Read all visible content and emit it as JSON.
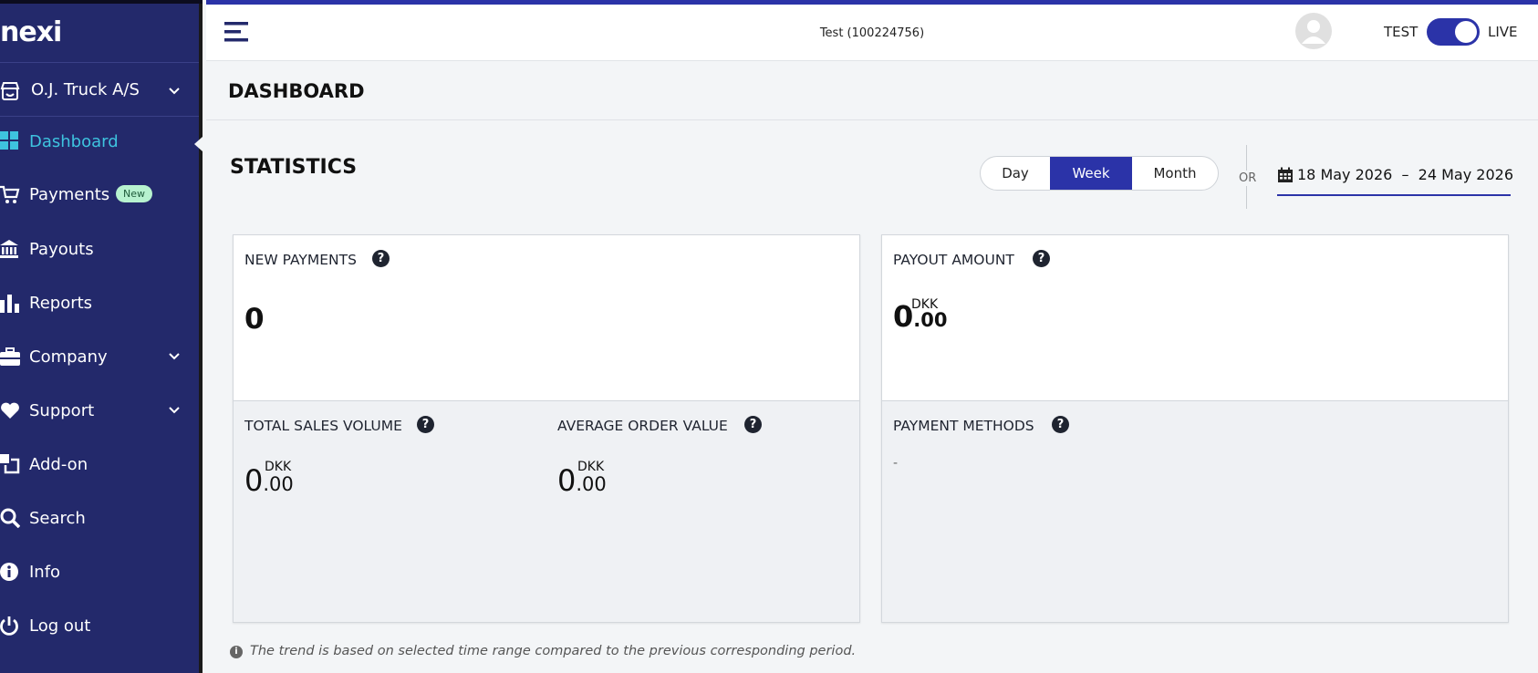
{
  "brand": {
    "logo_text": "nexi",
    "accent": "#2b33a8",
    "sidebar_bg": "#23296b",
    "active_color": "#3ec3df"
  },
  "sidebar": {
    "merchant": {
      "name": "O.J. Truck A/S",
      "icon": "store-icon"
    },
    "items": [
      {
        "label": "Dashboard",
        "icon": "grid-icon",
        "active": true
      },
      {
        "label": "Payments",
        "icon": "cart-icon",
        "badge": "New"
      },
      {
        "label": "Payouts",
        "icon": "bank-icon"
      },
      {
        "label": "Reports",
        "icon": "bar-chart-icon"
      },
      {
        "label": "Company",
        "icon": "briefcase-icon",
        "expandable": true
      },
      {
        "label": "Support",
        "icon": "heart-icon",
        "expandable": true
      },
      {
        "label": "Add-on",
        "icon": "addon-icon"
      },
      {
        "label": "Search",
        "icon": "search-icon"
      },
      {
        "label": "Info",
        "icon": "info-icon"
      },
      {
        "label": "Log out",
        "icon": "power-icon"
      }
    ]
  },
  "header": {
    "account": "Test (100224756)",
    "toggle": {
      "left_label": "TEST",
      "right_label": "LIVE",
      "state": "LIVE"
    }
  },
  "page": {
    "title": "DASHBOARD"
  },
  "statistics": {
    "title": "STATISTICS",
    "ranges": [
      "Day",
      "Week",
      "Month"
    ],
    "selected_range": "Week",
    "or_label": "OR",
    "date_from": "18 May 2026",
    "date_sep": "–",
    "date_to": "24 May 2026"
  },
  "cards": {
    "new_payments": {
      "label": "NEW PAYMENTS",
      "value": "0"
    },
    "payout_amount": {
      "label": "PAYOUT AMOUNT",
      "int": "0",
      "dec": ".00",
      "currency": "DKK"
    },
    "total_sales": {
      "label": "TOTAL SALES VOLUME",
      "int": "0",
      "dec": ".00",
      "currency": "DKK"
    },
    "avg_order": {
      "label": "AVERAGE ORDER VALUE",
      "int": "0",
      "dec": ".00",
      "currency": "DKK"
    },
    "payment_methods": {
      "label": "PAYMENT METHODS",
      "value": "-"
    }
  },
  "help_glyph": "?",
  "info_glyph": "i",
  "footnote": "The trend is based on selected time range compared to the previous corresponding period."
}
